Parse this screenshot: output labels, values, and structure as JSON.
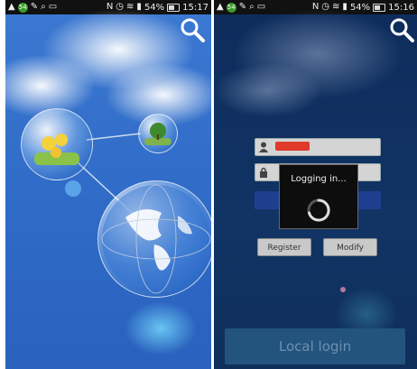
{
  "left_screen": {
    "status": {
      "badge": "54",
      "battery": "54%",
      "time": "15:17"
    }
  },
  "right_screen": {
    "status": {
      "badge": "54",
      "battery": "54%",
      "time": "15:16"
    },
    "dialog_text": "Logging in...",
    "register_label": "Register",
    "modify_label": "Modify",
    "local_login_label": "Local login"
  },
  "colors": {
    "accent": "#e03a2a",
    "sky": "#2e6ac6",
    "overlay": "#0f2f5a"
  }
}
